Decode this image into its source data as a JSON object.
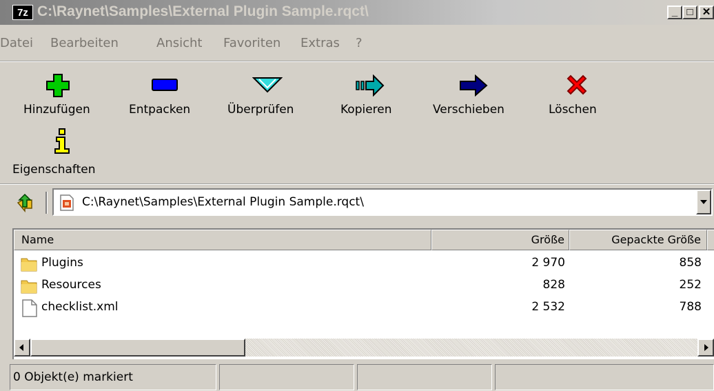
{
  "window": {
    "app_badge": "7z",
    "title": "C:\\Raynet\\Samples\\External Plugin Sample.rqct\\",
    "min_label": "_",
    "max_label": "□",
    "close_label": "✕"
  },
  "menu": [
    "Datei",
    "Bearbeiten",
    "Ansicht",
    "Favoriten",
    "Extras",
    "?"
  ],
  "toolbar": {
    "add": "Hinzufügen",
    "extract": "Entpacken",
    "test": "Überprüfen",
    "copy": "Kopieren",
    "move": "Verschieben",
    "delete": "Löschen",
    "info": "Eigenschaften"
  },
  "address": {
    "path": "C:\\Raynet\\Samples\\External Plugin Sample.rqct\\"
  },
  "columns": {
    "name": "Name",
    "size": "Größe",
    "packed": "Gepackte Größe"
  },
  "files": [
    {
      "name": "Plugins",
      "size": "2 970",
      "packed": "858",
      "icon": "folder-icon"
    },
    {
      "name": "Resources",
      "size": "828",
      "packed": "252",
      "icon": "folder-icon"
    },
    {
      "name": "checklist.xml",
      "size": "2 532",
      "packed": "788",
      "icon": "file-icon"
    }
  ],
  "status": {
    "selected": "0 Objekt(e) markiert"
  },
  "colors": {
    "add": "#00cc00",
    "extract": "#0000ff",
    "test": "#00cccc",
    "copy": "#009999",
    "move": "#000080",
    "delete": "#ff0000",
    "info": "#ffff00"
  }
}
